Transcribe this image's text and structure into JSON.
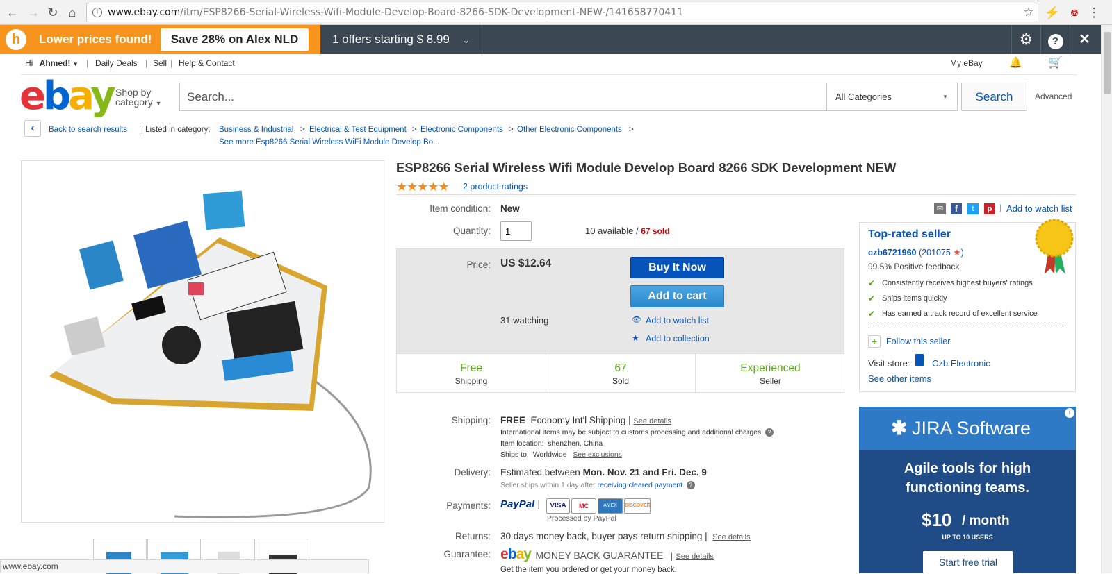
{
  "browser": {
    "url_host": "www.ebay.com",
    "url_path": "/itm/ESP8266-Serial-Wireless-Wifi-Module-Develop-Board-8266-SDK-Development-NEW-/141658770411",
    "status_url": "www.ebay.com"
  },
  "honey": {
    "lower_prices": "Lower prices found!",
    "save_label": "Save 28% on Alex NLD",
    "offers": "1 offers starting $ 8.99"
  },
  "toplinks": {
    "hi": "Hi",
    "user": "Ahmed!",
    "daily_deals": "Daily Deals",
    "sell": "Sell",
    "help": "Help & Contact",
    "my_ebay": "My eBay"
  },
  "header": {
    "shop_by_1": "Shop by",
    "shop_by_2": "category",
    "search_placeholder": "Search...",
    "category": "All Categories",
    "search_button": "Search",
    "advanced": "Advanced"
  },
  "breadcrumb": {
    "back": "Back to search results",
    "listed_in": "| Listed in category:",
    "items": [
      "Business & Industrial",
      "Electrical & Test Equipment",
      "Electronic Components",
      "Other Electronic Components"
    ],
    "see_more": "See more Esp8266 Serial Wireless WiFi Module Develop Bo..."
  },
  "product": {
    "title": "ESP8266 Serial Wireless Wifi Module Develop Board 8266 SDK Development NEW",
    "ratings": "2 product ratings",
    "condition_label": "Item condition:",
    "condition": "New",
    "quantity_label": "Quantity:",
    "quantity": "1",
    "available": "10 available /",
    "sold": "67 sold",
    "price_label": "Price:",
    "price": "US $12.64",
    "buy_now": "Buy It Now",
    "add_to_cart": "Add to cart",
    "watching": "31 watching",
    "add_watch": "Add to watch list",
    "add_collection": "Add to collection",
    "watch_list_top": "Add to watch list"
  },
  "stats": [
    {
      "big": "Free",
      "small": "Shipping"
    },
    {
      "big": "67",
      "small": "Sold"
    },
    {
      "big": "Experienced",
      "small": "Seller"
    }
  ],
  "shipping": {
    "label": "Shipping:",
    "free": "FREE",
    "service": "Economy Int'l Shipping |",
    "see_details": "See details",
    "customs": "International items may be subject to customs processing and additional charges.",
    "location_label": "Item location:",
    "location": "shenzhen, China",
    "ships_to_label": "Ships to:",
    "ships_to": "Worldwide",
    "see_exclusions": "See exclusions"
  },
  "delivery": {
    "label": "Delivery:",
    "est": "Estimated between",
    "dates": "Mon. Nov. 21 and Fri. Dec. 9",
    "note": "Seller ships within 1 day after",
    "note_link": "receiving cleared payment",
    "note_end": "."
  },
  "payments": {
    "label": "Payments:",
    "paypal": "PayPal",
    "cards": [
      "VISA",
      "MC",
      "AMEX",
      "DISCOVER"
    ],
    "processed": "Processed by PayPal"
  },
  "returns": {
    "label": "Returns:",
    "text": "30 days money back, buyer pays return shipping |",
    "see_details": "See details"
  },
  "guarantee": {
    "label": "Guarantee:",
    "mbg": "MONEY BACK GUARANTEE",
    "see_details": "See details",
    "note": "Get the item you ordered or get your money back."
  },
  "seller": {
    "top_rated": "Top-rated seller",
    "name": "czb6721960",
    "feedback_count": "201075",
    "positive": "99.5% Positive feedback",
    "checks": [
      "Consistently receives highest buyers' ratings",
      "Ships items quickly",
      "Has earned a track record of excellent service"
    ],
    "follow": "Follow this seller",
    "visit_store": "Visit store:",
    "store": "Czb Electronic",
    "see_other": "See other items"
  },
  "ad": {
    "brand": "JIRA Software",
    "headline_1": "Agile tools for high",
    "headline_2": "functioning teams.",
    "price": "$10",
    "per": "/ month",
    "users": "UP TO 10 USERS",
    "cta": "Start free trial"
  }
}
